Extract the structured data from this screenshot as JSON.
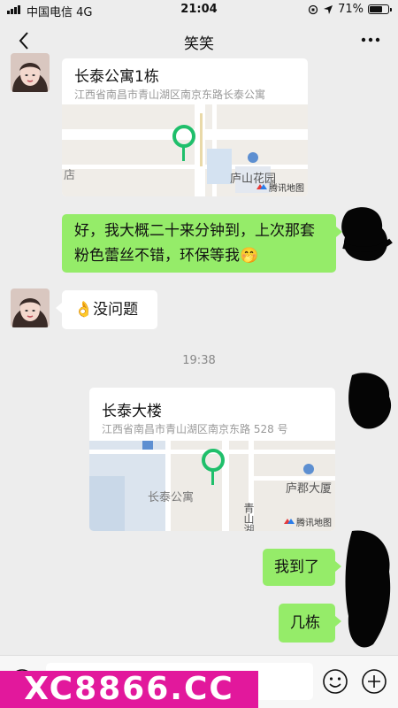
{
  "status_bar": {
    "carrier": "中国电信",
    "network": "4G",
    "time": "21:04",
    "battery": "71%",
    "battery_level": 0.71
  },
  "nav": {
    "title": "笑笑"
  },
  "messages": {
    "loc1": {
      "name": "长泰公寓1栋",
      "address": "江西省南昌市青山湖区南京东路长泰公寓",
      "map_labels": {
        "place": "庐山花园",
        "edge": "店",
        "brand": "腾讯地图"
      }
    },
    "text1": "好，我大概二十来分钟到，上次那套粉色蕾丝不错，环保等我🤭",
    "reply": "👌没问题",
    "timestamp": "19:38",
    "loc2": {
      "name": "长泰大楼",
      "address": "江西省南昌市青山湖区南京东路 528 号",
      "map_labels": {
        "place": "长泰公寓",
        "place2": "庐郡大厦",
        "road": "青山湖",
        "brand": "腾讯地图"
      }
    },
    "text2": "我到了",
    "text3": "几栋"
  },
  "watermark": "XC8866.CC",
  "colors": {
    "bubble_green": "#95ec69",
    "background": "#ededed",
    "pin_green": "#1fbf6b",
    "watermark": "#e2189c"
  }
}
